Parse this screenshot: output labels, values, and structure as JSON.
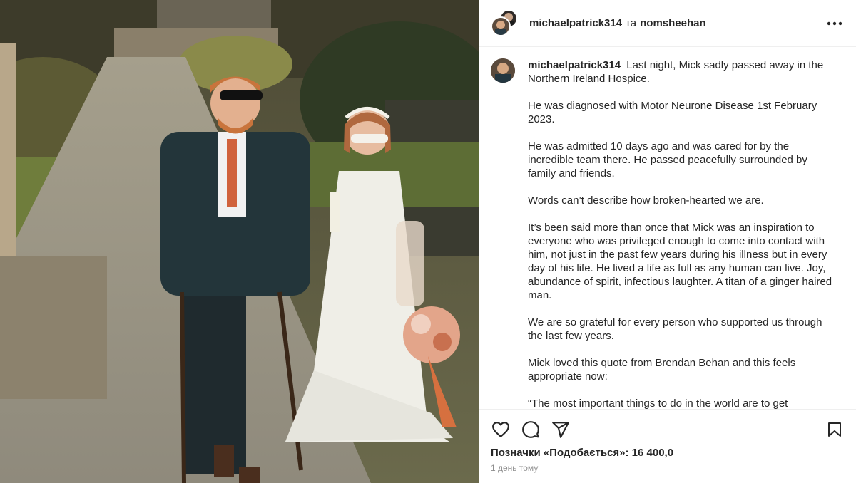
{
  "header": {
    "user1": "michaelpatrick314",
    "conjunction": "та",
    "user2": "nomsheehan",
    "more_icon": "more-horizontal-icon"
  },
  "caption": {
    "username": "michaelpatrick314",
    "paragraphs": [
      "Last night, Mick sadly passed away in the Northern Ireland Hospice.",
      "He was diagnosed with Motor Neurone Disease 1st February 2023.",
      "He was admitted 10 days ago and was cared for by the incredible team there. He passed peacefully surrounded by family and friends.",
      "Words can’t describe how broken-hearted we are.",
      "It’s been said more than once that Mick was an inspiration to everyone who was privileged enough to come into contact with him, not just in the past few years during his illness but in every day of his life. He lived a life as full as any human can live. Joy, abundance of spirit, infectious laughter. A titan of a ginger haired man.",
      "We are so grateful for every person who supported us through the last few years.",
      "Mick loved this quote from Brendan Behan and this feels appropriate now:",
      "“The most important things to do in the world are to get"
    ]
  },
  "actions": {
    "icons": [
      "heart-icon",
      "comment-icon",
      "share-icon",
      "bookmark-icon"
    ],
    "likes": "Позначки «Подобається»: 16 400,0",
    "time": "1 день тому"
  }
}
